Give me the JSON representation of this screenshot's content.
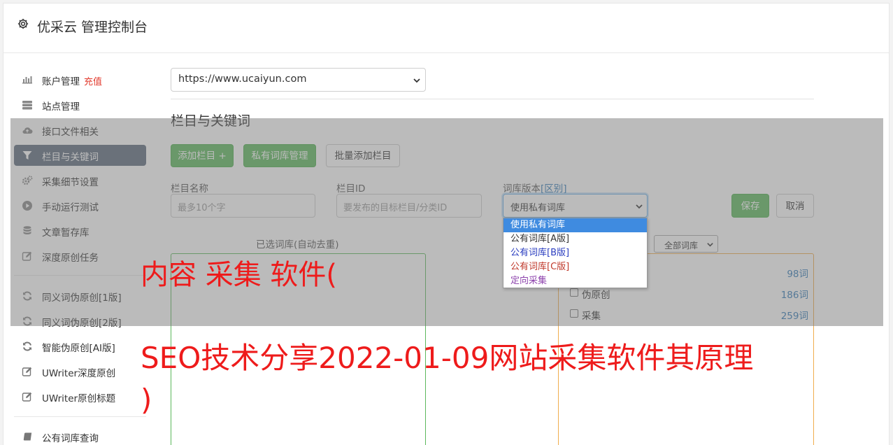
{
  "app": {
    "title": "优采云 管理控制台",
    "settings_icon": "gear-icon"
  },
  "sidebar": {
    "items": [
      {
        "label": "账户管理",
        "badge": "充值",
        "icon": "bar-chart-icon"
      },
      {
        "label": "站点管理",
        "icon": "server-icon"
      },
      {
        "label": "接口文件相关",
        "icon": "cloud-upload-icon"
      },
      {
        "label": "栏目与关键词",
        "icon": "filter-icon",
        "active": true
      },
      {
        "label": "采集细节设置",
        "icon": "cogs-icon"
      },
      {
        "label": "手动运行测试",
        "icon": "play-circle-icon"
      },
      {
        "label": "文章暂存库",
        "icon": "database-icon"
      },
      {
        "label": "深度原创任务",
        "icon": "edit-icon"
      },
      {
        "label": "同义词伪原创[1版]",
        "icon": "refresh-icon"
      },
      {
        "label": "同义词伪原创[2版]",
        "icon": "refresh-icon"
      },
      {
        "label": "智能伪原创[AI版]",
        "icon": "refresh-icon"
      },
      {
        "label": "UWriter深度原创",
        "icon": "edit-icon"
      },
      {
        "label": "UWriter原创标题",
        "icon": "edit-icon"
      },
      {
        "label": "公有词库查询",
        "icon": "book-icon"
      }
    ]
  },
  "main": {
    "site_select": {
      "value": "https://www.ucaiyun.com"
    },
    "section_title": "栏目与关键词",
    "buttons": {
      "add_column": "添加栏目 +",
      "private_lib": "私有词库管理",
      "batch_add": "批量添加栏目"
    },
    "form": {
      "column_name_label": "栏目名称",
      "column_name_placeholder": "最多10个字",
      "column_id_label": "栏目ID",
      "column_id_placeholder": "要发布的目标栏目/分类ID",
      "lib_version_label": "词库版本",
      "lib_version_link": "[区别]",
      "lib_version_value": "使用私有词库",
      "save": "保存",
      "cancel": "取消"
    },
    "lib_version_options": [
      {
        "label": "使用私有词库",
        "selected": true,
        "color": "#ffffff"
      },
      {
        "label": "公有词库[A版]",
        "color": "#333333"
      },
      {
        "label": "公有词库[B版]",
        "color": "#2b3ec0"
      },
      {
        "label": "公有词库[C版]",
        "color": "#c0392b"
      },
      {
        "label": "定向采集",
        "color": "#8e44ad"
      }
    ],
    "selected_libs_caption": "已选词库(自动去重)",
    "lib_filter_value": "全部词库",
    "libs": [
      {
        "name": "",
        "count": "98词"
      },
      {
        "name": "伪原创",
        "count": "186词"
      },
      {
        "name": "采集",
        "count": "259词"
      }
    ]
  },
  "watermark": {
    "line1": "内容 采集 软件(",
    "line2": "SEO技术分享2022-01-09网站采集软件其原理",
    "line3": ")"
  },
  "colors": {
    "accent_green": "#5cb85c",
    "active_nav": "#5d6b7d",
    "watermark_red": "#ee1b1b",
    "link_blue": "#337ab7"
  }
}
